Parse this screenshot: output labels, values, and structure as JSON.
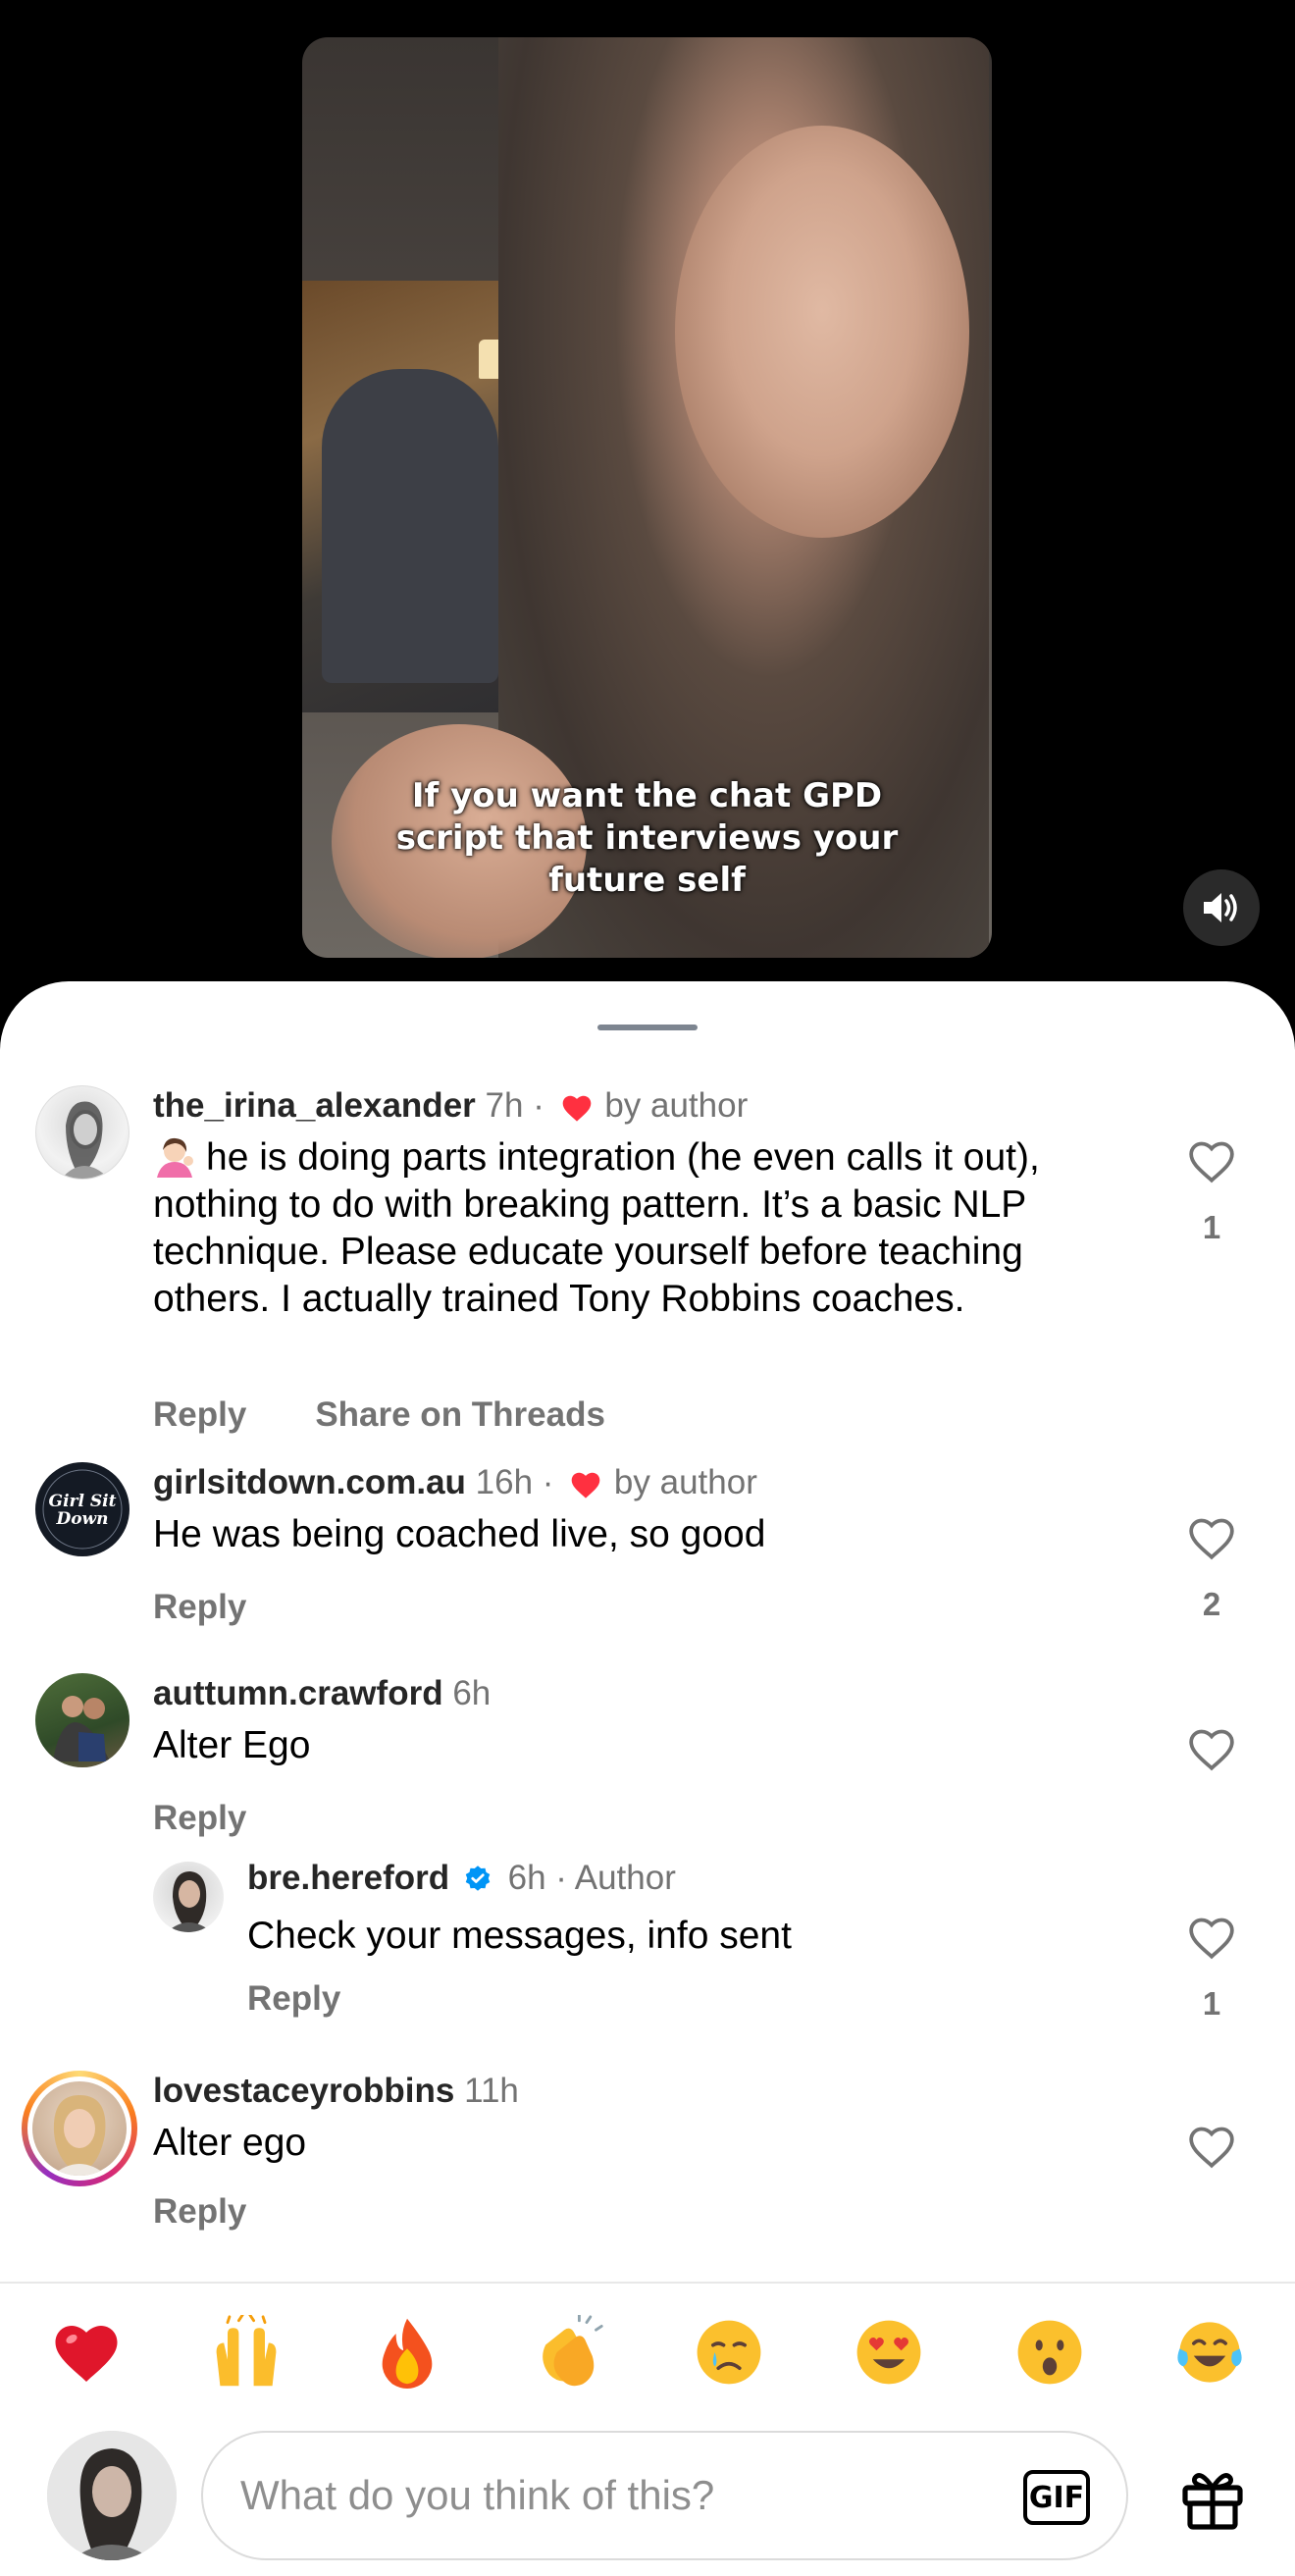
{
  "video": {
    "caption": "If you want the chat GPD script that interviews your future self"
  },
  "comments": [
    {
      "username": "the_irina_alexander",
      "time": "7h",
      "separator": "·",
      "liked_by_author_label": "by author",
      "text": "he is doing parts integration (he even calls it out), nothing to do with breaking pattern. It’s a basic NLP technique. Please educate yourself before teaching others. I actually trained Tony Robbins coaches.",
      "emoji_icon": "woman-tipping-hand-icon",
      "reply_label": "Reply",
      "share_label": "Share on Threads",
      "like_count": "1"
    },
    {
      "username": "girlsitdown.com.au",
      "time": "16h",
      "separator": "·",
      "liked_by_author_label": "by author",
      "avatar_text": "Girl Sit Down",
      "text": "He was being coached live, so good",
      "reply_label": "Reply",
      "like_count": "2"
    },
    {
      "username": "auttumn.crawford",
      "time": "6h",
      "text": "Alter Ego",
      "reply_label": "Reply"
    },
    {
      "username": "bre.hereford",
      "time": "6h",
      "separator": "·",
      "author_label": "Author",
      "verified": true,
      "text": "Check your messages, info sent",
      "reply_label": "Reply",
      "like_count": "1"
    },
    {
      "username": "lovestaceyrobbins",
      "time": "11h",
      "text": "Alter ego",
      "reply_label": "Reply"
    }
  ],
  "reactions": [
    "red-heart-icon",
    "raising-hands-icon",
    "fire-icon",
    "clapping-hands-icon",
    "crying-face-icon",
    "heart-eyes-icon",
    "surprised-face-icon",
    "tears-of-joy-icon"
  ],
  "input": {
    "placeholder": "What do you think of this?",
    "gif_label": "GIF"
  },
  "colors": {
    "heart_red": "#ff3040",
    "verified_blue": "#0095f6",
    "meta_gray": "#737373",
    "story_ring_start": "#feda75",
    "story_ring_end": "#d62976"
  }
}
